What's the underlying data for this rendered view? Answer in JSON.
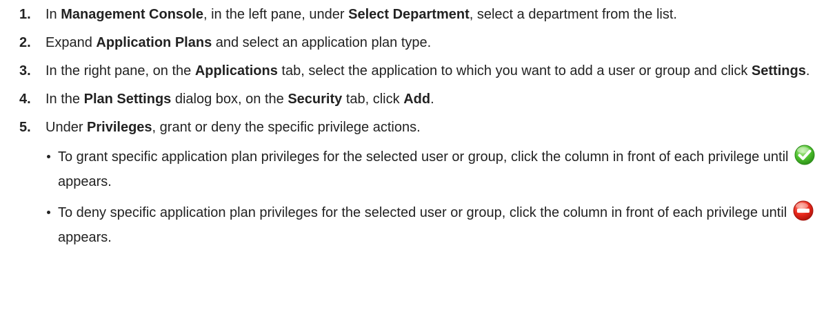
{
  "steps": [
    {
      "num": "1.",
      "t1": "In ",
      "b1": "Management Console",
      "t2": ", in the left pane, under ",
      "b2": "Select Department",
      "t3": ", select a department from the list."
    },
    {
      "num": "2.",
      "t1": "Expand ",
      "b1": "Application Plans",
      "t2": " and select an application plan type."
    },
    {
      "num": "3.",
      "t1": "In the right pane, on the ",
      "b1": "Applications",
      "t2": " tab, select the application to which you want to add a user or group and click ",
      "b2": "Settings",
      "t3": "."
    },
    {
      "num": "4.",
      "t1": "In the ",
      "b1": "Plan Settings",
      "t2": " dialog box, on the ",
      "b2": "Security",
      "t3": " tab, click ",
      "b3": "Add",
      "t4": "."
    },
    {
      "num": "5.",
      "t1": "Under ",
      "b1": "Privileges",
      "t2": ", grant or deny the specific privilege actions."
    }
  ],
  "bullets": [
    {
      "before": "To grant specific application plan privileges for the selected user or group, click the column in front of each privilege until",
      "icon": "green-check-icon",
      "after": "appears."
    },
    {
      "before": "To deny specific application plan privileges for the selected user or group, click the column in front of each privilege until",
      "icon": "red-deny-icon",
      "after": "appears."
    }
  ],
  "colors": {
    "text": "#222222",
    "grant_icon": "#3fae2a",
    "deny_icon": "#e2231a"
  }
}
